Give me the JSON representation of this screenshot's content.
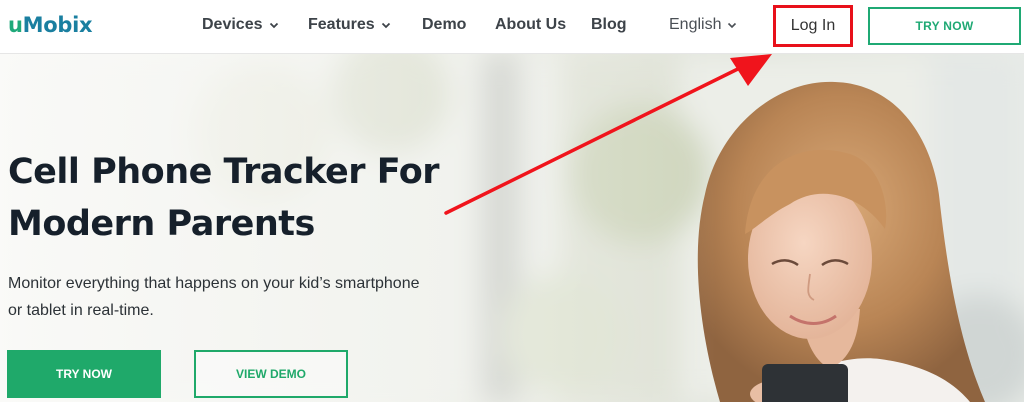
{
  "header": {
    "logo_u": "u",
    "logo_rest": "Mobix",
    "nav": {
      "devices": "Devices",
      "features": "Features",
      "demo": "Demo",
      "about": "About Us",
      "blog": "Blog",
      "language": "English"
    },
    "login_label": "Log In",
    "cta_label": "TRY NOW"
  },
  "hero": {
    "title_line1": "Cell Phone Tracker For",
    "title_line2": "Modern Parents",
    "subtitle_line1": "Monitor everything that happens on your kid’s smartphone",
    "subtitle_line2": "or tablet in real-time.",
    "try_label": "TRY NOW",
    "demo_label": "VIEW DEMO"
  },
  "colors": {
    "brand_green": "#1fa96a",
    "brand_blue": "#1a7fa0",
    "highlight_red": "#e8101a",
    "title_dark": "#16202b"
  },
  "icons": [
    "chevron-down-icon",
    "red-arrow-annotation"
  ]
}
